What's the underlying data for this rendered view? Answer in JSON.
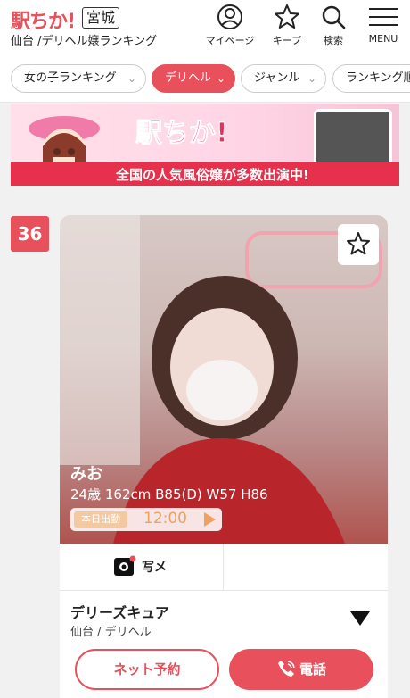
{
  "header": {
    "logo": "駅ちか!",
    "prefecture": "宮城",
    "subtitle": "仙台 /デリヘル嬢ランキング",
    "icons": [
      {
        "icon": "user-circle-icon",
        "label": "マイページ"
      },
      {
        "icon": "star-outline-icon",
        "label": "キープ"
      },
      {
        "icon": "search-icon",
        "label": "検索"
      },
      {
        "icon": "hamburger-menu-icon",
        "label": "MENU"
      }
    ]
  },
  "filters": [
    {
      "label": "女の子ランキング",
      "active": false
    },
    {
      "label": "デリヘル",
      "active": true
    },
    {
      "label": "ジャンル",
      "active": false
    },
    {
      "label": "ランキング順",
      "active": false
    }
  ],
  "banner": {
    "logo_text": "駅ちか!",
    "tagline": "全国の人気風俗嬢が多数出演中!"
  },
  "card": {
    "rank": "36",
    "name": "みお",
    "profile": "24歳 162cm B85(D) W57 H86",
    "shift_badge": "本日出勤",
    "shift_time": "12:00",
    "photo_button": "写メ",
    "shop_name": "デリーズキュア",
    "shop_area": "仙台 / デリヘル",
    "reserve_button": "ネット予約",
    "call_button": "電話"
  },
  "colors": {
    "accent": "#e8505b",
    "background": "#f1f1f1"
  }
}
